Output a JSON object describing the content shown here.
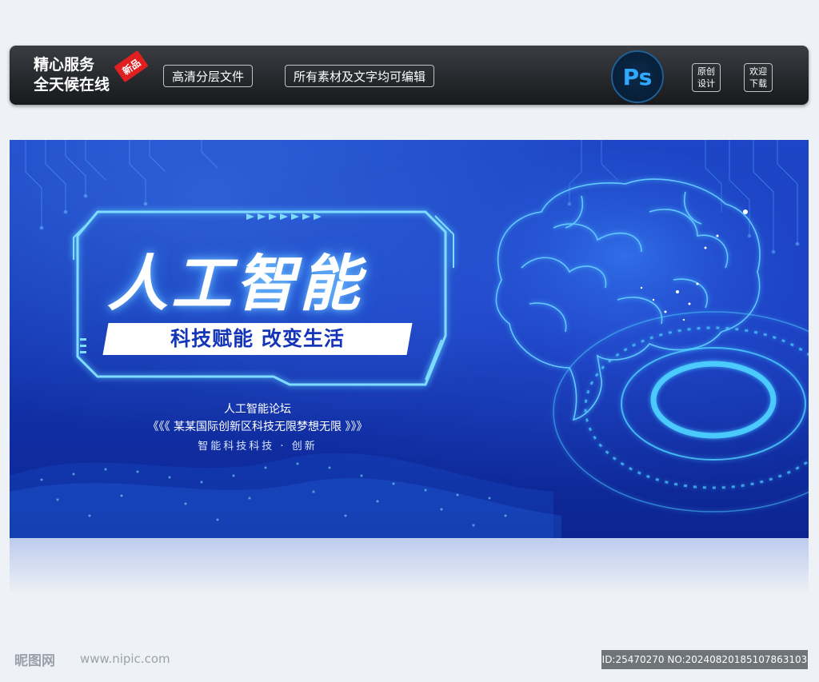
{
  "topbar": {
    "service_line1": "精心服务",
    "service_line2": "全天候在线",
    "badge": "新品",
    "pill1": "高清分层文件",
    "pill2": "所有素材及文字均可编辑",
    "ps_logo": "Ps",
    "box1_line1": "原创",
    "box1_line2": "设计",
    "box2_line1": "欢迎",
    "box2_line2": "下载"
  },
  "banner": {
    "title": "人工智能",
    "subtitle": "科技赋能 改变生活",
    "forum": "人工智能论坛",
    "tagline": "《《《 某某国际创新区科技无限梦想无限 》》》",
    "slogan": "智能科技科技 · 创新"
  },
  "watermark": {
    "logo": "昵图网",
    "url": "www.nipic.com",
    "id_text": "ID:25470270 NO:20240820185107863103"
  },
  "colors": {
    "banner_blue": "#1d46c6",
    "glow_cyan": "#5fd7ff",
    "subtitle_text": "#1535b8"
  }
}
